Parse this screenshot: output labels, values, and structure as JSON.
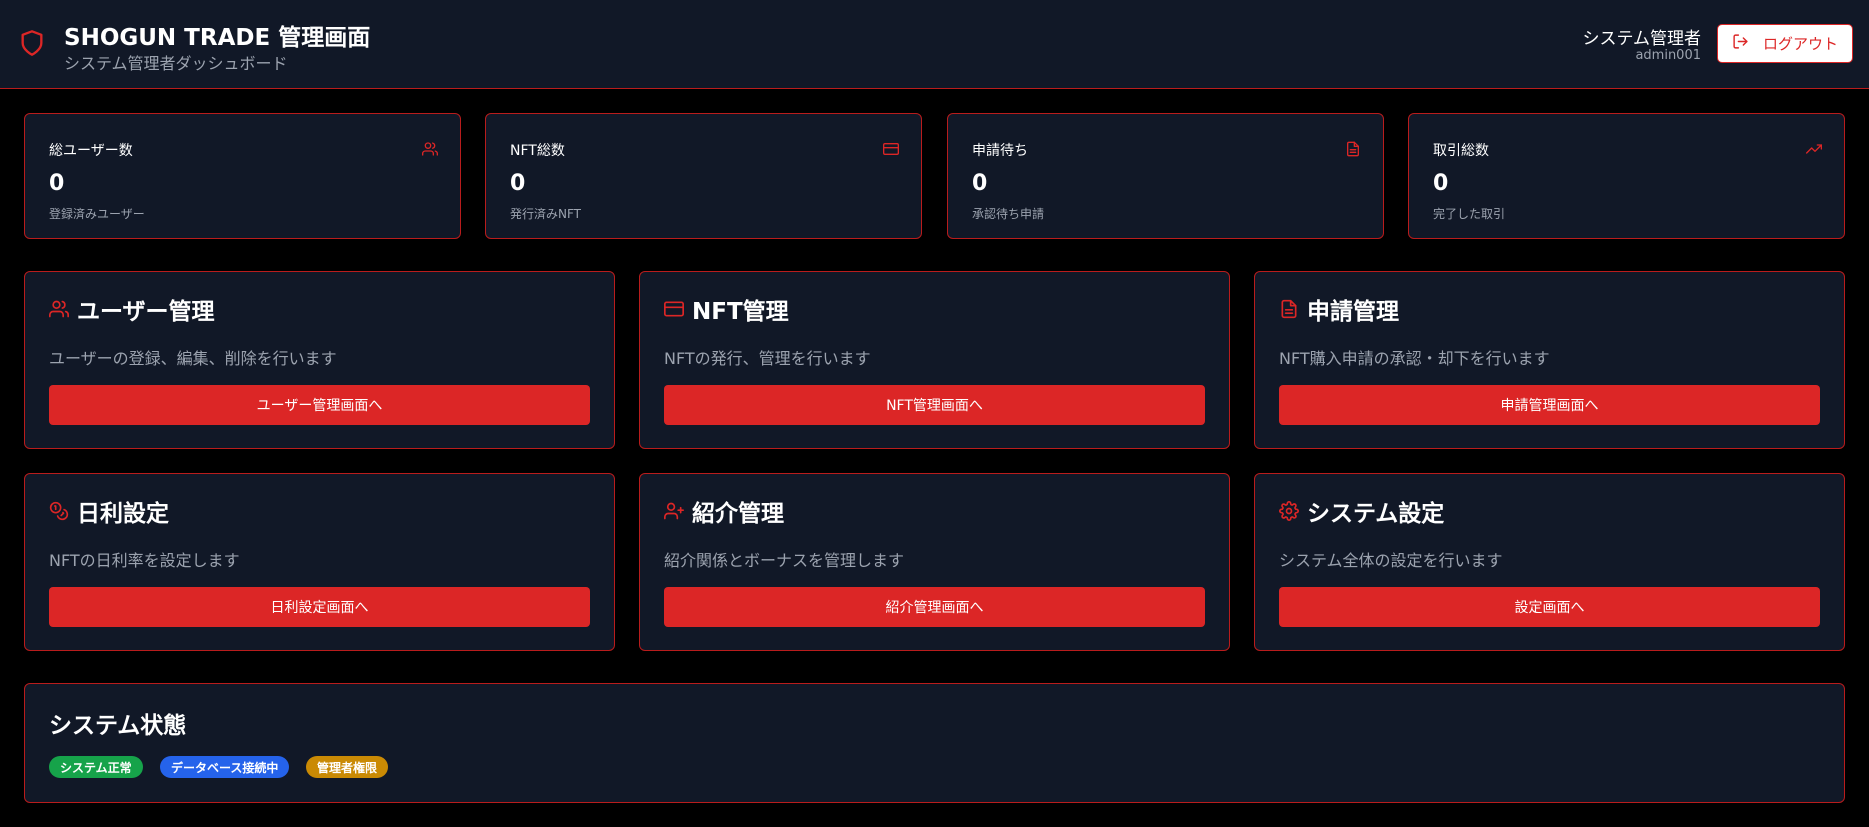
{
  "header": {
    "title": "SHOGUN TRADE 管理画面",
    "subtitle": "システム管理者ダッシュボード",
    "user_role": "システム管理者",
    "user_id": "admin001",
    "logout_label": "ログアウト",
    "shield_icon": "shield-icon",
    "logout_icon": "logout-icon"
  },
  "stats": [
    {
      "label": "総ユーザー数",
      "value": "0",
      "desc": "登録済みユーザー",
      "icon": "users-icon"
    },
    {
      "label": "NFT総数",
      "value": "0",
      "desc": "発行済みNFT",
      "icon": "credit-card-icon"
    },
    {
      "label": "申請待ち",
      "value": "0",
      "desc": "承認待ち申請",
      "icon": "file-text-icon"
    },
    {
      "label": "取引総数",
      "value": "0",
      "desc": "完了した取引",
      "icon": "trending-up-icon"
    }
  ],
  "modules": [
    {
      "title": "ユーザー管理",
      "desc": "ユーザーの登録、編集、削除を行います",
      "button": "ユーザー管理画面へ",
      "icon": "users-icon"
    },
    {
      "title": "NFT管理",
      "desc": "NFTの発行、管理を行います",
      "button": "NFT管理画面へ",
      "icon": "credit-card-icon"
    },
    {
      "title": "申請管理",
      "desc": "NFT購入申請の承認・却下を行います",
      "button": "申請管理画面へ",
      "icon": "file-text-icon"
    },
    {
      "title": "日利設定",
      "desc": "NFTの日利率を設定します",
      "button": "日利設定画面へ",
      "icon": "coins-icon"
    },
    {
      "title": "紹介管理",
      "desc": "紹介関係とボーナスを管理します",
      "button": "紹介管理画面へ",
      "icon": "user-plus-icon"
    },
    {
      "title": "システム設定",
      "desc": "システム全体の設定を行います",
      "button": "設定画面へ",
      "icon": "gear-icon"
    }
  ],
  "system_status": {
    "title": "システム状態",
    "badges": [
      {
        "label": "システム正常",
        "color": "#16a34a"
      },
      {
        "label": "データベース接続中",
        "color": "#2563eb"
      },
      {
        "label": "管理者権限",
        "color": "#ca8a04"
      }
    ]
  },
  "colors": {
    "accent": "#dc2626",
    "card_bg": "#111827",
    "border": "#b91c1c",
    "page_bg": "#000000"
  }
}
